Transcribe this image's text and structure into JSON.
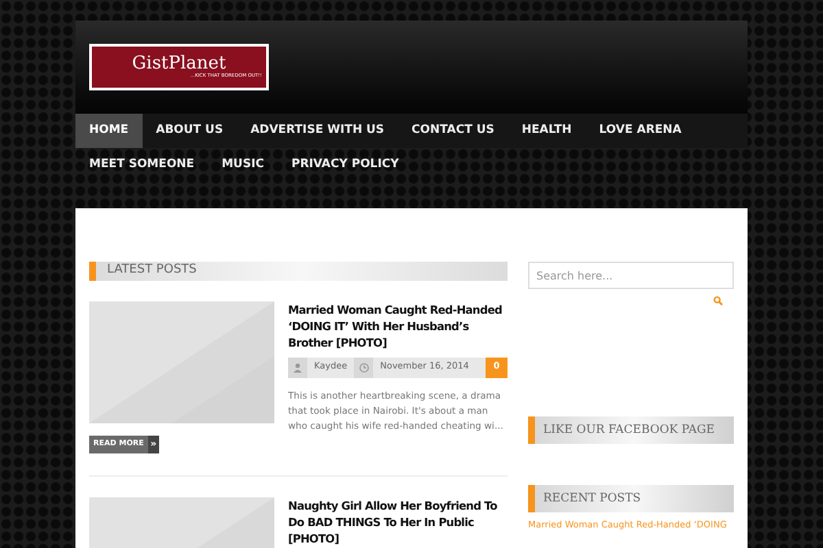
{
  "logo": {
    "name": "GistPlanet",
    "tagline": "...KICK THAT BOREDOM OUT!!"
  },
  "nav": [
    {
      "label": "HOME",
      "selected": true
    },
    {
      "label": "ABOUT US",
      "selected": false
    },
    {
      "label": "ADVERTISE WITH US",
      "selected": false
    },
    {
      "label": "CONTACT US",
      "selected": false
    },
    {
      "label": "HEALTH",
      "selected": false
    },
    {
      "label": "LOVE ARENA",
      "selected": false
    },
    {
      "label": "MEET SOMEONE",
      "selected": false
    },
    {
      "label": "MUSIC",
      "selected": false
    },
    {
      "label": "PRIVACY POLICY",
      "selected": false
    }
  ],
  "latest_posts": {
    "title": "LATEST POSTS",
    "posts": [
      {
        "title": "Married Woman Caught Red-Handed ‘DOING IT’ With Her Husband’s Brother [PHOTO]",
        "author": "Kaydee",
        "date": "November 16, 2014",
        "comments": "0",
        "excerpt": "This is another heartbreaking scene, a drama that took place in Nairobi. It's about a man who caught his wife red-handed cheating wi...",
        "read_more": "READ MORE",
        "arrow": "»"
      },
      {
        "title": "Naughty Girl Allow Her Boyfriend To Do BAD THINGS To Her In Public [PHOTO]"
      }
    ]
  },
  "sidebar": {
    "search": {
      "placeholder": "Search here..."
    },
    "facebook_title": "LIKE OUR FACEBOOK PAGE",
    "recent_title": "RECENT POSTS",
    "recent_posts": [
      "Married Woman Caught Red-Handed ‘DOING"
    ]
  }
}
